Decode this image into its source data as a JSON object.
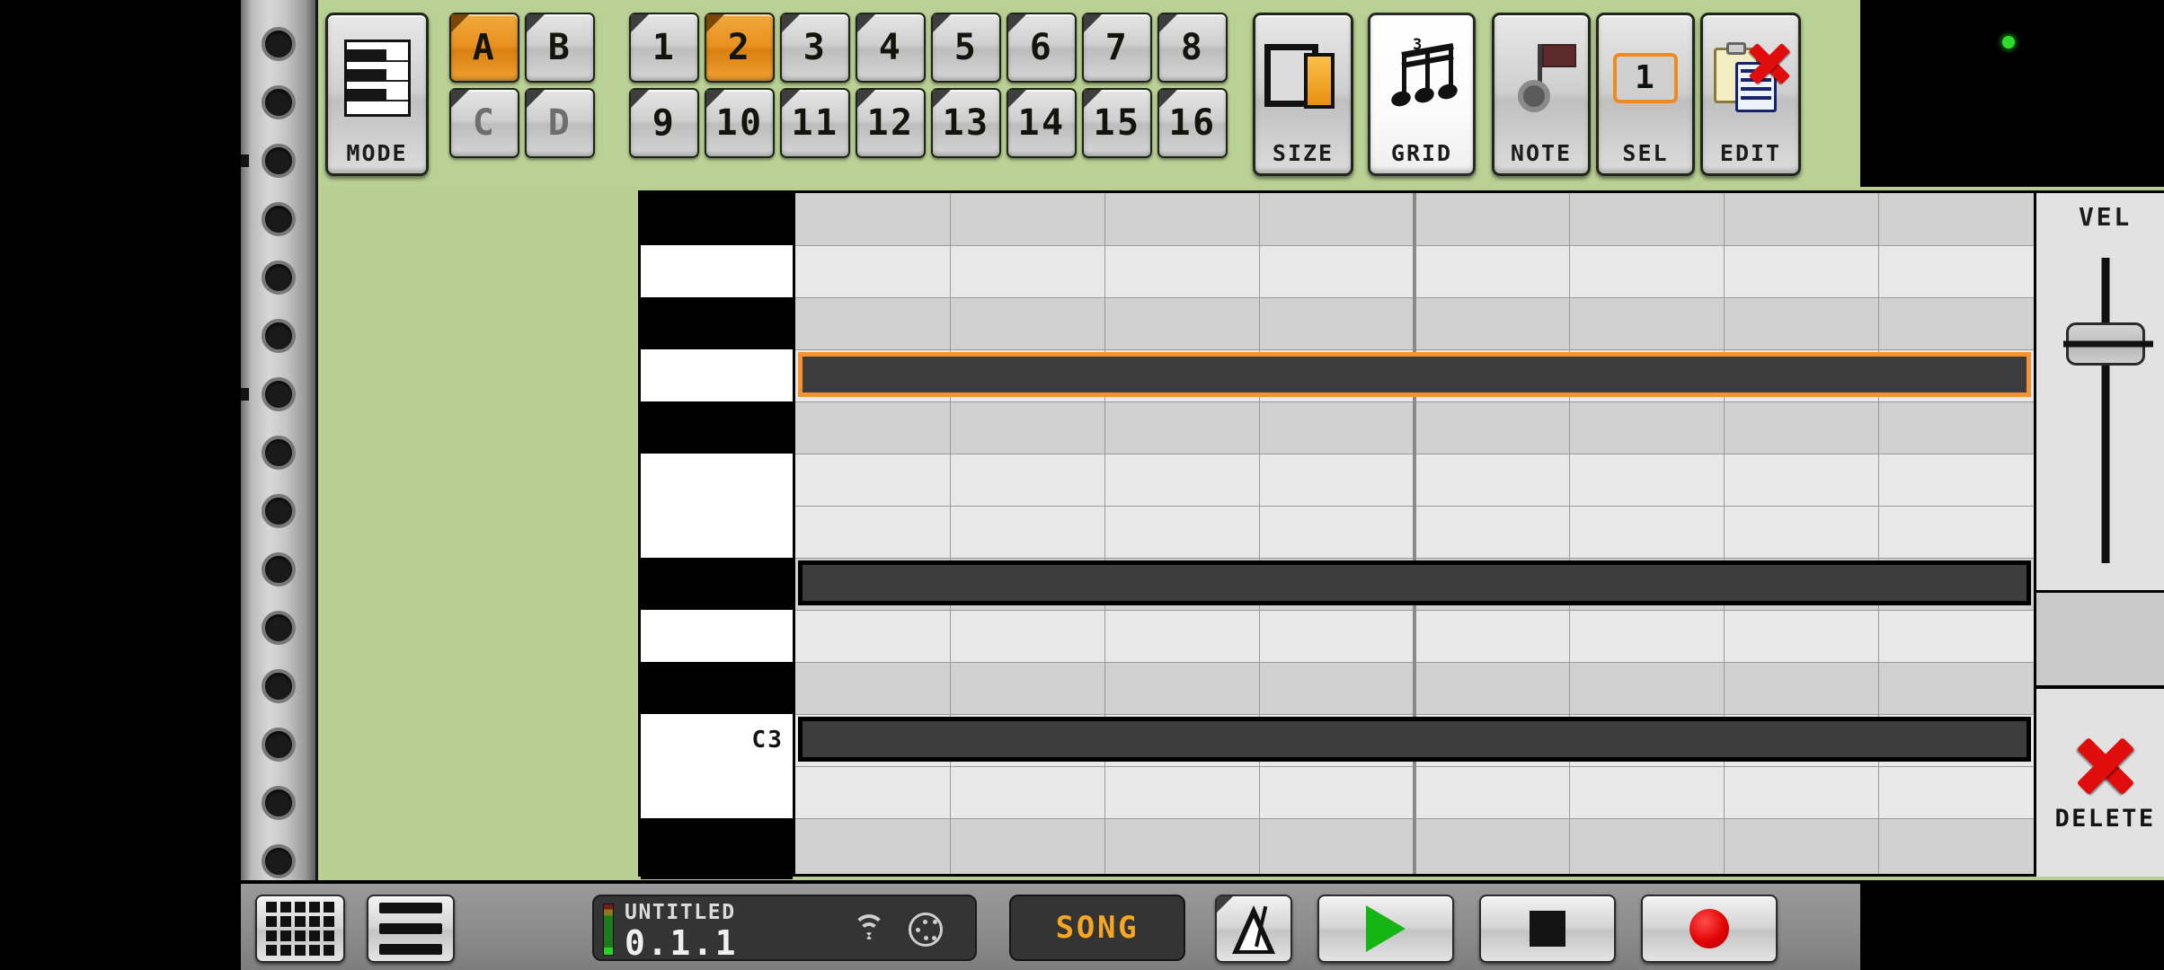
{
  "toolbar": {
    "mode": {
      "label": "Mode",
      "icon": "piano-keys-icon"
    },
    "banks": [
      {
        "label": "A",
        "active": true
      },
      {
        "label": "B",
        "active": false
      },
      {
        "label": "C",
        "active": false,
        "dim": true
      },
      {
        "label": "D",
        "active": false,
        "dim": true
      }
    ],
    "patterns": [
      {
        "label": "1",
        "active": false
      },
      {
        "label": "2",
        "active": true
      },
      {
        "label": "3",
        "active": false
      },
      {
        "label": "4",
        "active": false
      },
      {
        "label": "5",
        "active": false
      },
      {
        "label": "6",
        "active": false
      },
      {
        "label": "7",
        "active": false
      },
      {
        "label": "8",
        "active": false
      },
      {
        "label": "9",
        "active": false
      },
      {
        "label": "10",
        "active": false
      },
      {
        "label": "11",
        "active": false
      },
      {
        "label": "12",
        "active": false
      },
      {
        "label": "13",
        "active": false
      },
      {
        "label": "14",
        "active": false
      },
      {
        "label": "15",
        "active": false
      },
      {
        "label": "16",
        "active": false
      }
    ],
    "size": {
      "label": "Size",
      "icon": "two-pages-icon"
    },
    "grid": {
      "label": "Grid",
      "icon": "triplet-notes-icon",
      "triplet": "3",
      "selected": true
    },
    "note": {
      "label": "Note",
      "icon": "gear-flag-note-icon"
    },
    "sel": {
      "label": "Sel",
      "value": "1"
    },
    "edit": {
      "label": "Edit",
      "icon": "clipboard-delete-icon"
    }
  },
  "editor": {
    "keyboard": {
      "labeled_key": "C3",
      "keys": [
        {
          "type": "black"
        },
        {
          "type": "white"
        },
        {
          "type": "black"
        },
        {
          "type": "white"
        },
        {
          "type": "black"
        },
        {
          "type": "white"
        },
        {
          "type": "white"
        },
        {
          "type": "black"
        },
        {
          "type": "white"
        },
        {
          "type": "black"
        },
        {
          "type": "white",
          "name": "C3"
        },
        {
          "type": "white"
        },
        {
          "type": "black"
        }
      ]
    },
    "grid": {
      "columns": 8,
      "bar_divider_after_column": 4,
      "notes": [
        {
          "row": 3,
          "start": 0.0,
          "length": 8.0,
          "selected": true
        },
        {
          "row": 7,
          "start": 0.0,
          "length": 8.0,
          "selected": false
        },
        {
          "row": 10,
          "start": 0.0,
          "length": 8.0,
          "selected": false
        }
      ]
    },
    "velocity": {
      "label": "Vel",
      "value_percent": 72
    },
    "delete": {
      "label": "Delete",
      "icon": "red-x-icon"
    }
  },
  "transport": {
    "pads_button": {
      "icon": "pad-grid-icon"
    },
    "menu_button": {
      "icon": "hamburger-menu-icon"
    },
    "display": {
      "title": "Untitled",
      "position": "0.1.1",
      "wifi_icon": "wifi-icon",
      "midi_icon": "midi-din-icon"
    },
    "song_button": {
      "label": "Song"
    },
    "metronome": {
      "icon": "metronome-icon"
    },
    "play": {
      "icon": "play-icon"
    },
    "stop": {
      "icon": "stop-icon"
    },
    "record": {
      "icon": "record-icon"
    }
  },
  "status": {
    "recording_dot_color": "#2ddc2d"
  }
}
